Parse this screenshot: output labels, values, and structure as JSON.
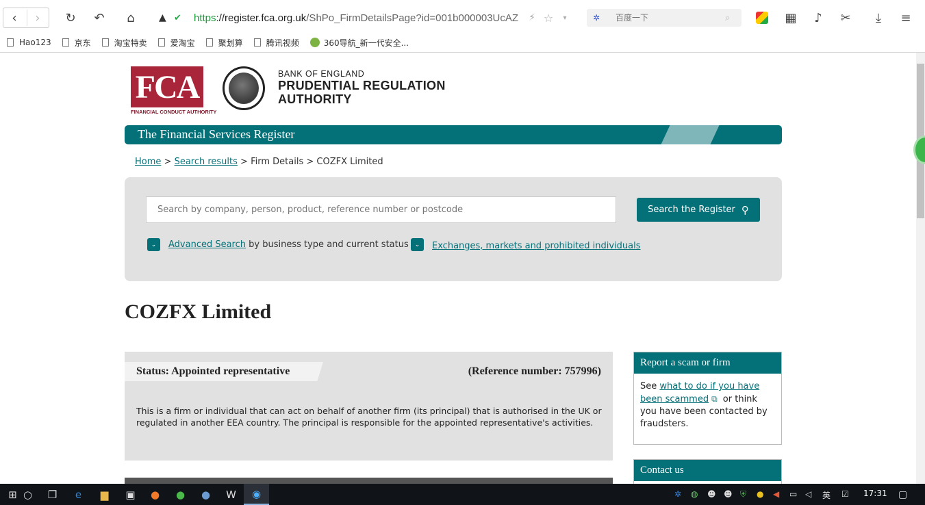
{
  "browser": {
    "url_scheme": "https",
    "url_host": "://register.fca.org.uk",
    "url_path": "/ShPo_FirmDetailsPage?id=001b000003UcAZ",
    "search_placeholder": "百度一下",
    "bookmarks": [
      "Hao123",
      "京东",
      "淘宝特卖",
      "爱淘宝",
      "聚划算",
      "腾讯视频",
      "360导航_新一代安全..."
    ]
  },
  "header": {
    "fca_logo_text": "FCA",
    "fca_logo_subtitle": "FINANCIAL CONDUCT AUTHORITY",
    "boe_line1": "BANK OF ENGLAND",
    "boe_line2": "PRUDENTIAL REGULATION",
    "boe_line3": "AUTHORITY",
    "banner_title": "The Financial Services Register"
  },
  "breadcrumb": {
    "home": "Home",
    "sep1": " > ",
    "search_results": "Search results",
    "sep2": "  > ",
    "firm_details": "Firm Details",
    "sep3": " > ",
    "current": "COZFX Limited"
  },
  "search": {
    "placeholder": "Search by company, person, product, reference number or postcode",
    "button_label": "Search the Register",
    "advanced_link": "Advanced Search",
    "advanced_suffix": " by business type and current status",
    "exchanges_link": "Exchanges, markets and prohibited individuals"
  },
  "firm": {
    "name": "COZFX Limited",
    "status": "Status: Appointed representative",
    "reference": "(Reference number: 757996)",
    "description": "This is a firm or individual that can act on behalf of another firm (its principal) that is authorised in the UK or regulated in another EEA country. The principal is responsible for the appointed representative's activities."
  },
  "sidebar": {
    "scam_title": "Report a scam or firm",
    "scam_prefix": "See ",
    "scam_link": "what to do if you have been scammed",
    "scam_suffix": " or think you have been contacted by fraudsters.",
    "contact_title": "Contact us"
  },
  "taskbar": {
    "ime": "英",
    "clock": "17:31"
  },
  "colors": {
    "fca_teal": "#047078",
    "fca_red": "#a9263a"
  }
}
